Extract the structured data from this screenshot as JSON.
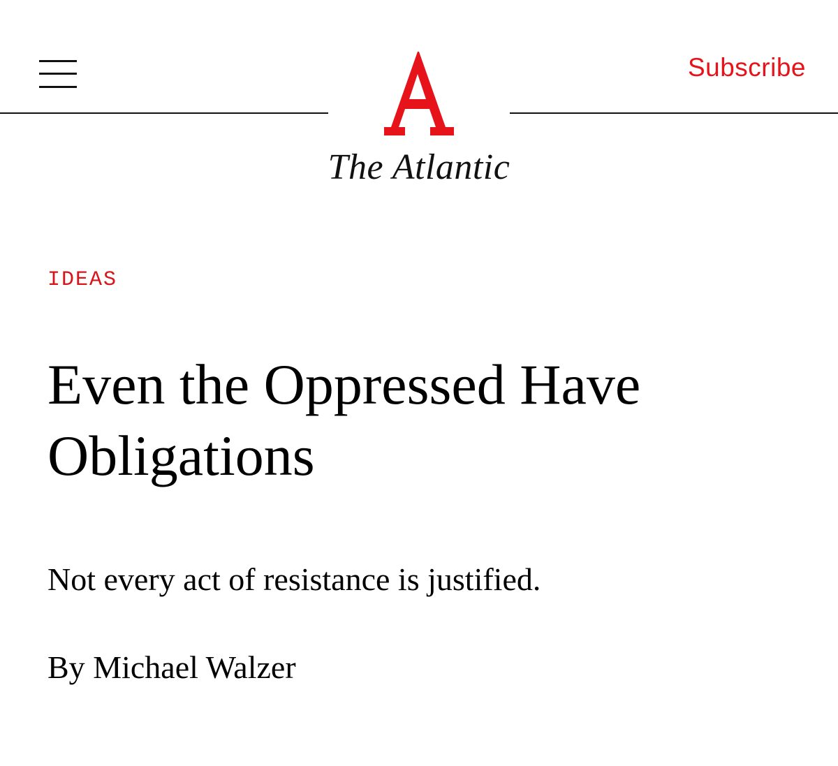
{
  "header": {
    "menu_icon": "hamburger-menu-icon",
    "logo_icon": "atlantic-a-logo",
    "brand_name": "The Atlantic",
    "subscribe_label": "Subscribe",
    "accent_color": "#e7131a"
  },
  "article": {
    "section": "IDEAS",
    "title": "Even the Oppressed Have Obligations",
    "dek": "Not every act of resistance is justified.",
    "byline_prefix": "By",
    "author": "Michael Walzer"
  }
}
